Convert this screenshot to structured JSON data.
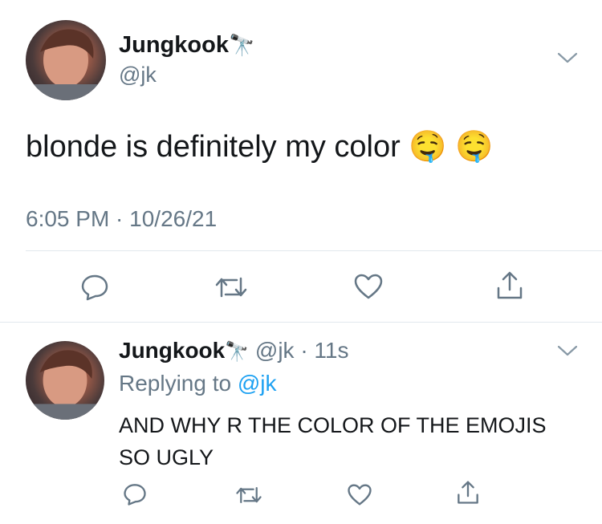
{
  "main_tweet": {
    "author_name": "Jungkook",
    "author_emoji": "🔭",
    "handle": "@jk",
    "text": "blonde is definitely my color",
    "emojis": "🤤 🤤",
    "timestamp": "6:05 PM · 10/26/21"
  },
  "reply_tweet": {
    "author_name": "Jungkook",
    "author_emoji": "🔭",
    "handle_time": "@jk · 11s",
    "replying_prefix": "Replying to ",
    "replying_handle": "@jk",
    "text_line1": "AND WHY R THE COLOR OF THE EMOJIS",
    "text_line2": "SO UGLY"
  },
  "colors": {
    "accent": "#1da1f2",
    "muted": "#657786",
    "divider": "#e1e8ed",
    "icon": "#657786"
  },
  "icons": [
    "chevron-down-icon",
    "reply-icon",
    "retweet-icon",
    "like-icon",
    "share-icon"
  ]
}
